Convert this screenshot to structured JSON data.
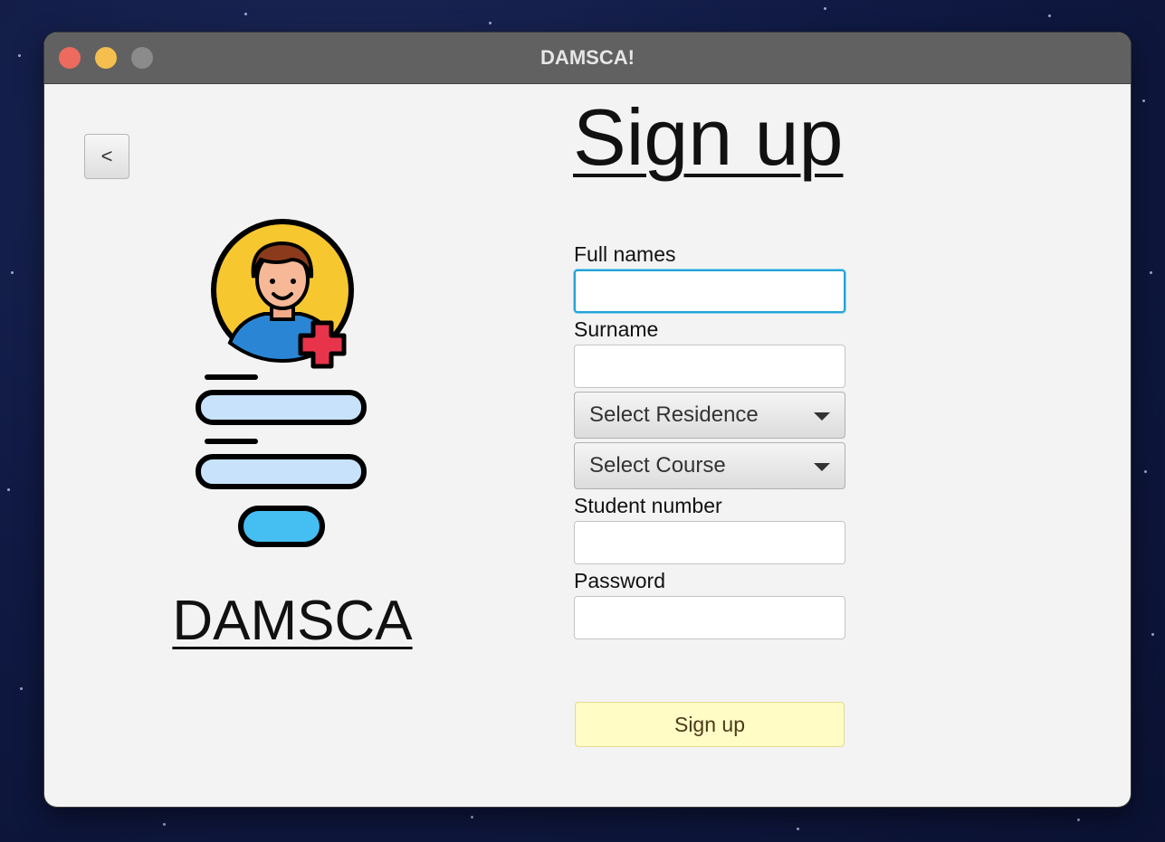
{
  "window": {
    "title": "DAMSCA!"
  },
  "left": {
    "back_label": "<",
    "brand": "DAMSCA"
  },
  "form": {
    "title": "Sign up",
    "full_names_label": "Full names",
    "surname_label": "Surname",
    "residence_select": "Select Residence",
    "course_select": "Select Course",
    "student_number_label": "Student number",
    "password_label": "Password",
    "submit_label": "Sign up"
  },
  "icons": [
    "user-add-icon",
    "form-illustration-icon",
    "chevron-down-icon"
  ],
  "colors": {
    "accent_focus": "#23a3d6",
    "button_bg": "#fffcc6",
    "field_fill": "#c8e2fb",
    "button_fill": "#45bef2"
  }
}
